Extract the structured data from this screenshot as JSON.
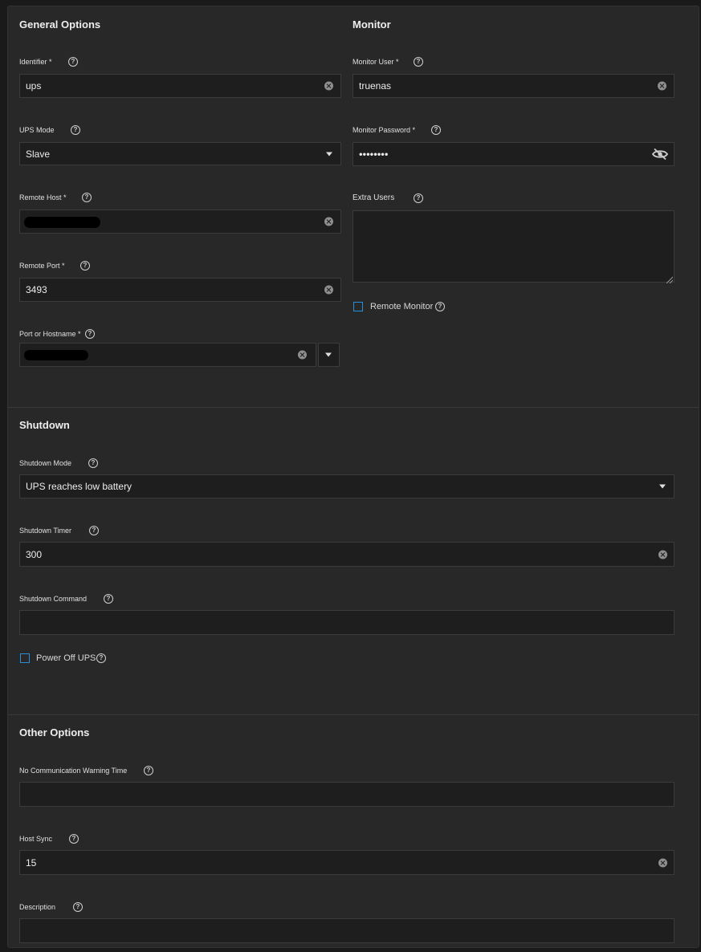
{
  "sections": {
    "general": "General Options",
    "monitor": "Monitor",
    "shutdown": "Shutdown",
    "other": "Other Options"
  },
  "general": {
    "identifier_label": "Identifier *",
    "identifier_value": "ups",
    "ups_mode_label": "UPS Mode",
    "ups_mode_value": "Slave",
    "remote_host_label": "Remote Host *",
    "remote_port_label": "Remote Port *",
    "remote_port_value": "3493",
    "port_label": "Port or Hostname *"
  },
  "monitor": {
    "user_label": "Monitor User *",
    "user_value": "truenas",
    "password_label": "Monitor Password *",
    "password_value": "••••••••",
    "extra_users_label": "Extra Users",
    "remote_monitor_label": "Remote Monitor"
  },
  "shutdown": {
    "mode_label": "Shutdown Mode",
    "mode_value": "UPS reaches low battery",
    "timer_label": "Shutdown Timer",
    "timer_value": "300",
    "command_label": "Shutdown Command",
    "power_off_label": "Power Off UPS"
  },
  "other": {
    "nocomm_label": "No Communication Warning Time",
    "hostsync_label": "Host Sync",
    "hostsync_value": "15",
    "description_label": "Description"
  },
  "help_glyph": "?",
  "colors": {
    "background": "#1a1a1a",
    "card": "#282828",
    "input": "#1e1e1e",
    "checkbox_border": "#2a8fd6"
  }
}
